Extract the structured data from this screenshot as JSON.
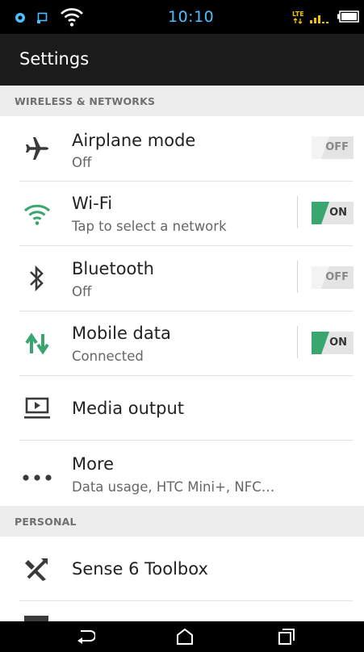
{
  "status_bar": {
    "time": "10:10",
    "icons": [
      "location-icon",
      "cast-icon",
      "wifi-icon",
      "lte-icon",
      "signal-icon",
      "battery-icon"
    ],
    "lte_label": "LTE"
  },
  "action_bar": {
    "title": "Settings"
  },
  "sections": {
    "wireless": {
      "header": "WIRELESS & NETWORKS"
    },
    "personal": {
      "header": "PERSONAL"
    }
  },
  "rows": {
    "airplane": {
      "title": "Airplane mode",
      "subtitle": "Off",
      "toggle": "OFF"
    },
    "wifi": {
      "title": "Wi-Fi",
      "subtitle": "Tap to select a network",
      "toggle": "ON"
    },
    "bluetooth": {
      "title": "Bluetooth",
      "subtitle": "Off",
      "toggle": "OFF"
    },
    "mobile": {
      "title": "Mobile data",
      "subtitle": "Connected",
      "toggle": "ON"
    },
    "media": {
      "title": "Media output"
    },
    "more": {
      "title": "More",
      "subtitle": "Data usage, HTC Mini+, NFC…"
    },
    "toolbox": {
      "title": "Sense 6 Toolbox"
    }
  },
  "colors": {
    "accent_green": "#3aa66f",
    "status_blue": "#4cc0ff"
  },
  "nav_icons": [
    "back-icon",
    "home-icon",
    "recent-apps-icon"
  ]
}
